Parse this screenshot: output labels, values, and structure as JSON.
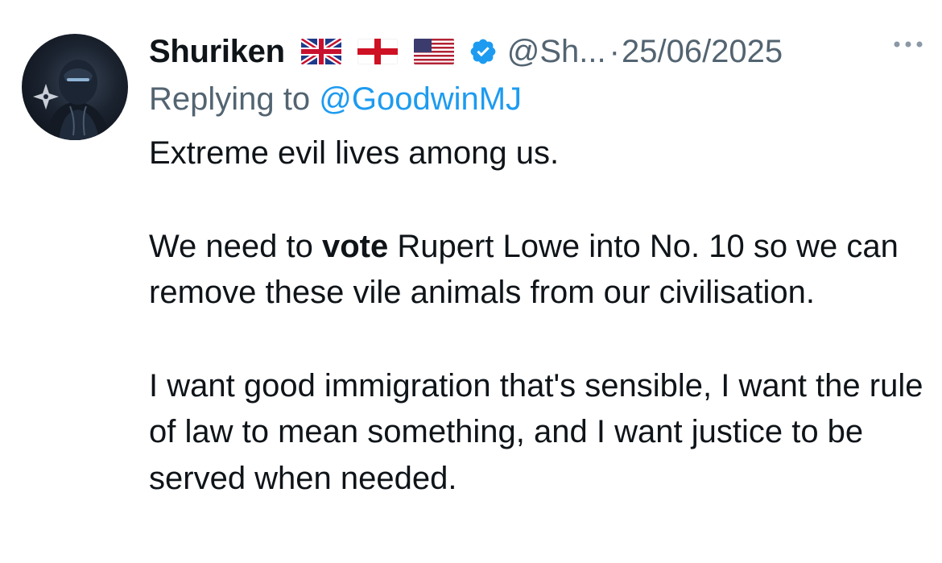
{
  "tweet": {
    "display_name": "Shuriken",
    "flags": [
      "uk-flag-icon",
      "england-flag-icon",
      "us-flag-icon"
    ],
    "verified_icon": "verified-badge-icon",
    "handle": "@Sh...",
    "separator": "·",
    "date": "25/06/2025",
    "more_icon": "more-options-icon",
    "reply_prefix": "Replying to ",
    "reply_to": "@GoodwinMJ",
    "paragraph_1": "Extreme evil lives among us.",
    "paragraph_2_before": "We need to ",
    "paragraph_2_bold": "vote",
    "paragraph_2_after": " Rupert Lowe into No. 10 so we can remove these vile animals from our civilisation.",
    "paragraph_3": "I want good immigration that's sensible, I want the rule of law to mean something, and I want justice to be served when needed."
  },
  "colors": {
    "text": "#0f1419",
    "secondary": "#536471",
    "link": "#1d9bf0",
    "verified": "#1d9bf0"
  }
}
